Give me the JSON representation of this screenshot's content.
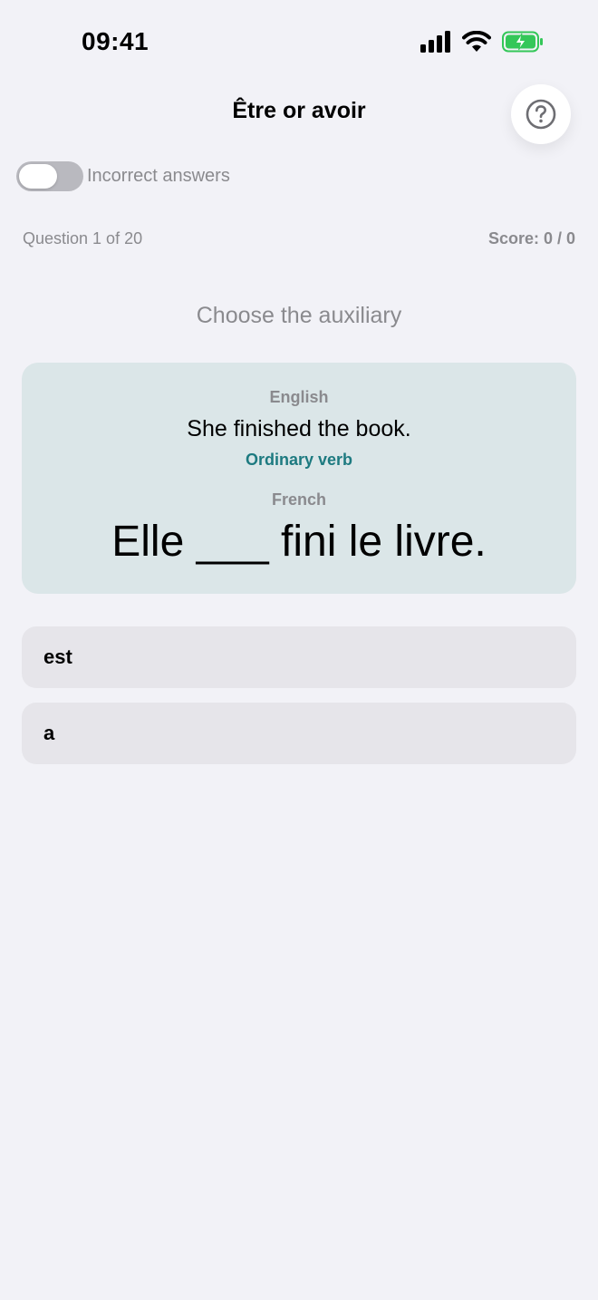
{
  "status_bar": {
    "time": "09:41",
    "icons": [
      "signal-icon",
      "wifi-icon",
      "battery-charging-icon"
    ]
  },
  "header": {
    "title": "Être or avoir",
    "help_icon": "question-mark-icon"
  },
  "filter": {
    "toggle_label": "Incorrect answers",
    "toggle_on": false
  },
  "progress": {
    "question_label": "Question 1 of 20",
    "score_label": "Score: 0 / 0"
  },
  "instruction": "Choose the auxiliary",
  "card": {
    "english_label": "English",
    "english_sentence": "She finished the book.",
    "verb_type": "Ordinary verb",
    "french_label": "French",
    "french_sentence": "Elle ___ fini le livre."
  },
  "answers": [
    {
      "label": "est"
    },
    {
      "label": "a"
    }
  ],
  "colors": {
    "background": "#f2f2f7",
    "card_background": "#dbe6e8",
    "accent_teal": "#1d7a80",
    "option_background": "#e6e5ea",
    "battery_green": "#34c759"
  }
}
